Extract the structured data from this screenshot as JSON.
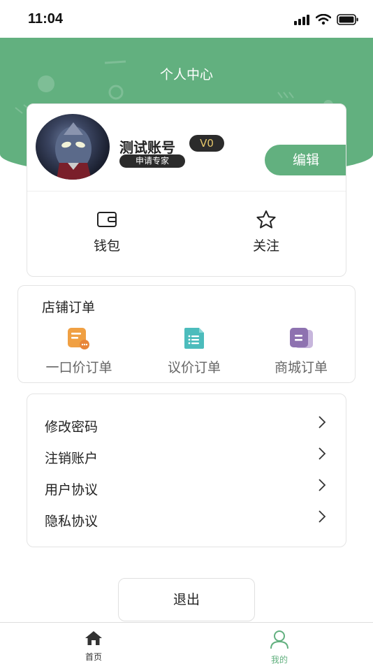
{
  "status_bar": {
    "time": "11:04"
  },
  "header": {
    "title": "个人中心"
  },
  "profile": {
    "username": "测试账号",
    "level": "V0",
    "expert_tag": "申请专家",
    "edit_label": "编辑"
  },
  "quick_actions": [
    {
      "label": "钱包",
      "icon": "wallet-icon"
    },
    {
      "label": "关注",
      "icon": "star-icon"
    }
  ],
  "shop_orders": {
    "title": "店铺订单",
    "items": [
      {
        "label": "一口价订单",
        "icon": "fixed-price-order-icon",
        "color": "#f0a043"
      },
      {
        "label": "议价订单",
        "icon": "negotiation-order-icon",
        "color": "#4cbcbc"
      },
      {
        "label": "商城订单",
        "icon": "mall-order-icon",
        "color": "#8e72b0"
      }
    ]
  },
  "settings": [
    {
      "label": "修改密码"
    },
    {
      "label": "注销账户"
    },
    {
      "label": "用户协议"
    },
    {
      "label": "隐私协议"
    }
  ],
  "logout_label": "退出",
  "tab_bar": {
    "tabs": [
      {
        "label": "首页",
        "icon": "home-icon",
        "active": false
      },
      {
        "label": "我的",
        "icon": "user-icon",
        "active": true
      }
    ]
  },
  "colors": {
    "accent": "#62b07f",
    "badge_bg": "#2b2b2b",
    "badge_text": "#e6c76a"
  }
}
